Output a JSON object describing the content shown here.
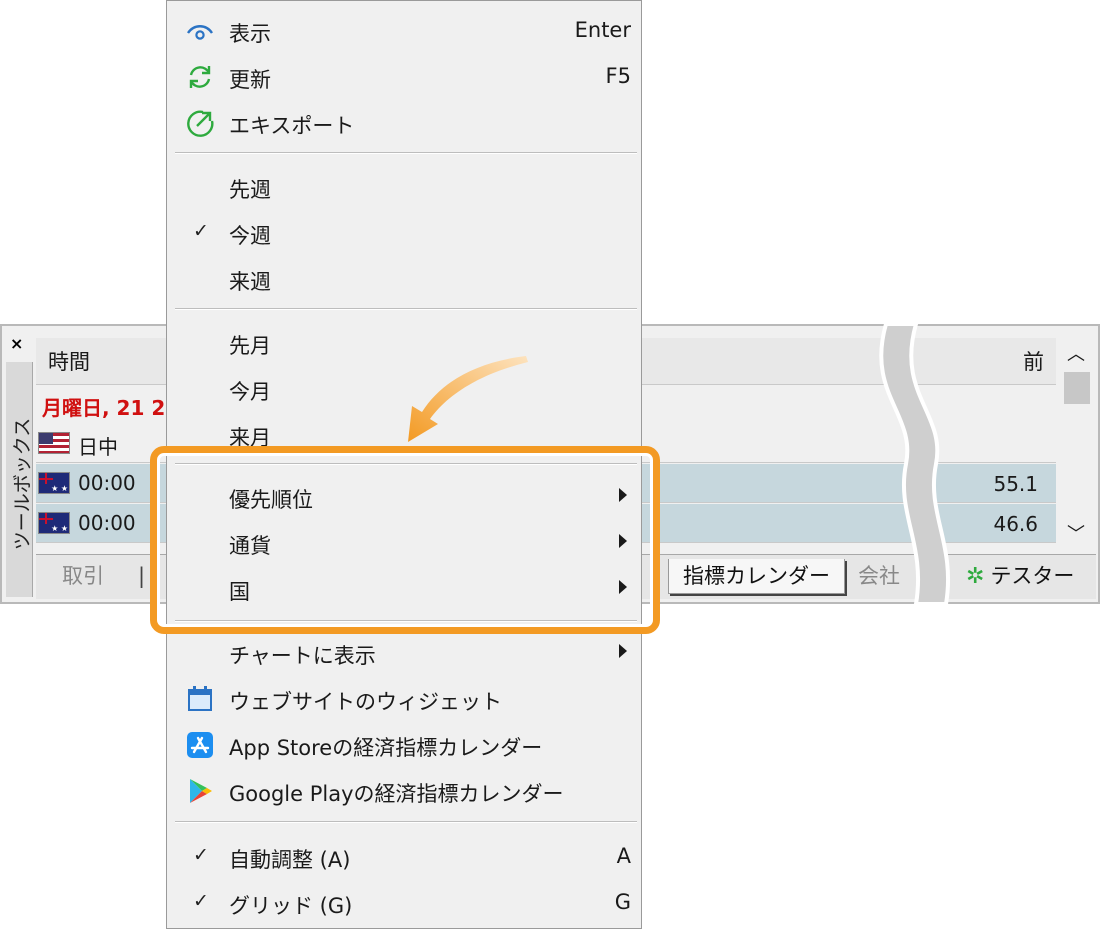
{
  "menu": {
    "view": {
      "label": "表示",
      "shortcut": "Enter",
      "icon": "eye-icon"
    },
    "refresh": {
      "label": "更新",
      "shortcut": "F5",
      "icon": "refresh-icon"
    },
    "export": {
      "label": "エキスポート",
      "icon": "export-icon"
    },
    "last_week": {
      "label": "先週"
    },
    "this_week": {
      "label": "今週",
      "checked": true
    },
    "next_week": {
      "label": "来週"
    },
    "last_month": {
      "label": "先月"
    },
    "this_month": {
      "label": "今月"
    },
    "next_month": {
      "label": "来月"
    },
    "priority": {
      "label": "優先順位",
      "submenu": true
    },
    "currency": {
      "label": "通貨",
      "submenu": true
    },
    "country": {
      "label": "国",
      "submenu": true
    },
    "show_on_chart": {
      "label": "チャートに表示",
      "submenu": true
    },
    "website_widget": {
      "label": "ウェブサイトのウィジェット",
      "icon": "calendar-icon"
    },
    "app_store": {
      "label": "App Storeの経済指標カレンダー",
      "icon": "app-store-icon"
    },
    "google_play": {
      "label": "Google Playの経済指標カレンダー",
      "icon": "google-play-icon"
    },
    "auto_arrange": {
      "label": "自動調整 (A)",
      "shortcut": "A",
      "checked": true
    },
    "grid": {
      "label": "グリッド (G)",
      "shortcut": "G",
      "checked": true
    }
  },
  "toolbox": {
    "close": "×",
    "side_label": "ツールボックス",
    "header": {
      "time": "時間",
      "previous": "前"
    },
    "date_row": "月曜日, 21 2",
    "rows": [
      {
        "flag": "US",
        "text": "日中",
        "value": ""
      },
      {
        "flag": "AU",
        "text": "00:00",
        "value": "55.1"
      },
      {
        "flag": "AU",
        "text": "00:00",
        "value": "46.6"
      }
    ],
    "tabs": {
      "trade": "取引",
      "calendar": "指標カレンダー",
      "company": "会社",
      "tester": "テスター"
    }
  },
  "colors": {
    "highlight": "#f39a23",
    "date_red": "#d01010",
    "row_shade": "#c6d7dd"
  }
}
